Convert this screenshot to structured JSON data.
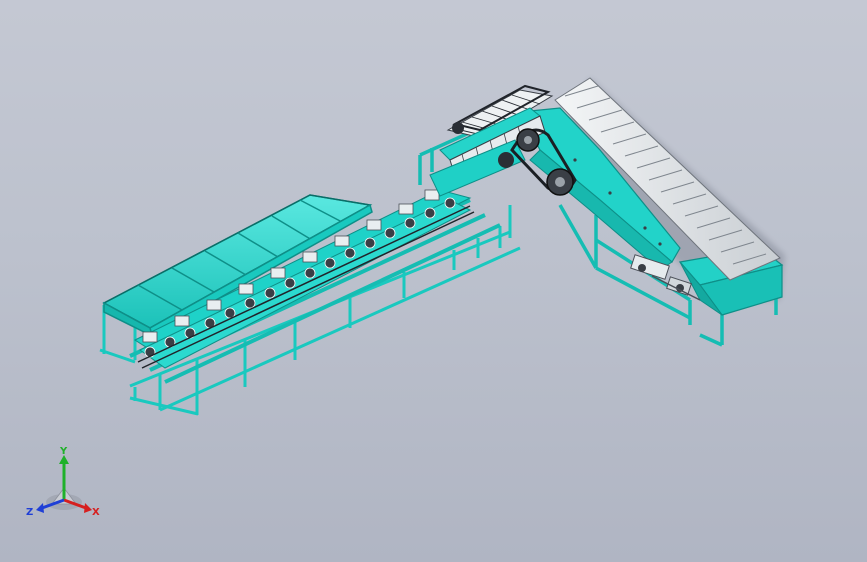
{
  "viewport": {
    "background_top": "#c4c8d3",
    "background_bottom": "#b0b5c3"
  },
  "model": {
    "description_icon": "sorting-conveyor-machine-icon",
    "frame_color": "#1fd6cc",
    "frame_dark": "#0e8f88",
    "bin_color": "#33dfd6",
    "roller_color": "#3a3f46",
    "belt_slat_color": "#e8ebee",
    "chain_color": "#20242a"
  },
  "axis_triad": {
    "x_label": "X",
    "y_label": "Y",
    "z_label": "Z",
    "x_color": "#d61f1f",
    "y_color": "#1fb12a",
    "z_color": "#1f3fd6"
  }
}
